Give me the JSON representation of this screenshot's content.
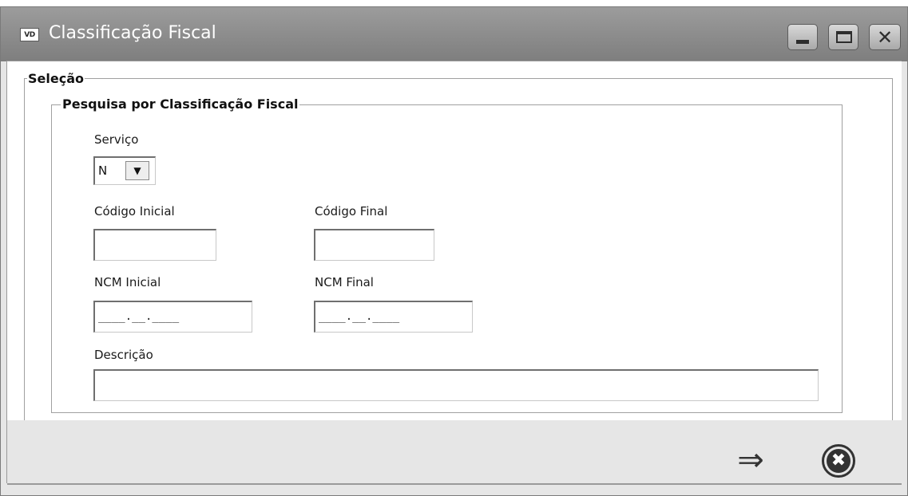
{
  "window": {
    "title": "Classificação Fiscal",
    "app_icon_text": "VD",
    "controls": {
      "minimize": "minimize-icon",
      "maximize": "maximize-icon",
      "close_glyph": "✕"
    }
  },
  "form": {
    "group_outer_label": "Seleção",
    "group_inner_label": "Pesquisa por Classificação Fiscal",
    "servico": {
      "label": "Serviço",
      "selected": "N",
      "arrow": "▼"
    },
    "codigo_inicial": {
      "label": "Código Inicial",
      "value": ""
    },
    "codigo_final": {
      "label": "Código Final",
      "value": ""
    },
    "ncm_inicial": {
      "label": "NCM Inicial",
      "mask": "____.__.____"
    },
    "ncm_final": {
      "label": "NCM Final",
      "mask": "____.__.____"
    },
    "descricao": {
      "label": "Descrição",
      "value": ""
    }
  },
  "footer": {
    "confirm_glyph": "⇒",
    "cancel_glyph": "✖"
  },
  "colors": {
    "titlebar": "#8c8c8c",
    "title_text": "#ffffff",
    "footer_bg": "#e6e6e6",
    "group_border": "#a0a0a0"
  }
}
